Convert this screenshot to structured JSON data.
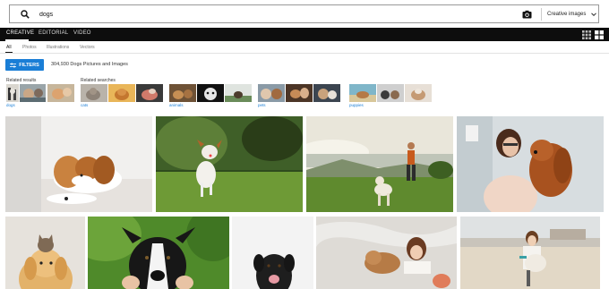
{
  "search": {
    "query": "dogs",
    "filter_label": "Creative images"
  },
  "nav": {
    "tabs": [
      "CREATIVE",
      "EDITORIAL",
      "VIDEO"
    ],
    "active": "CREATIVE"
  },
  "subtabs": [
    "All",
    "Photos",
    "Illustrations",
    "Vectors"
  ],
  "filters": {
    "button_label": "FILTERS",
    "result_count": "304,930 Dogs Pictures and Images"
  },
  "related_results": {
    "label": "Related results",
    "link": "dogs"
  },
  "related_searches": {
    "label": "Related searches",
    "links": [
      "cats",
      "animals",
      "pets",
      "puppies"
    ]
  },
  "icons": {
    "search": "search-icon",
    "camera": "camera-icon",
    "chevron": "chevron-down-icon",
    "filters": "sliders-icon",
    "grid_small": "grid-small-icon",
    "grid_large": "grid-large-icon"
  },
  "colors": {
    "nav_bg": "#0d0d0d",
    "accent": "#1a7ed6"
  }
}
